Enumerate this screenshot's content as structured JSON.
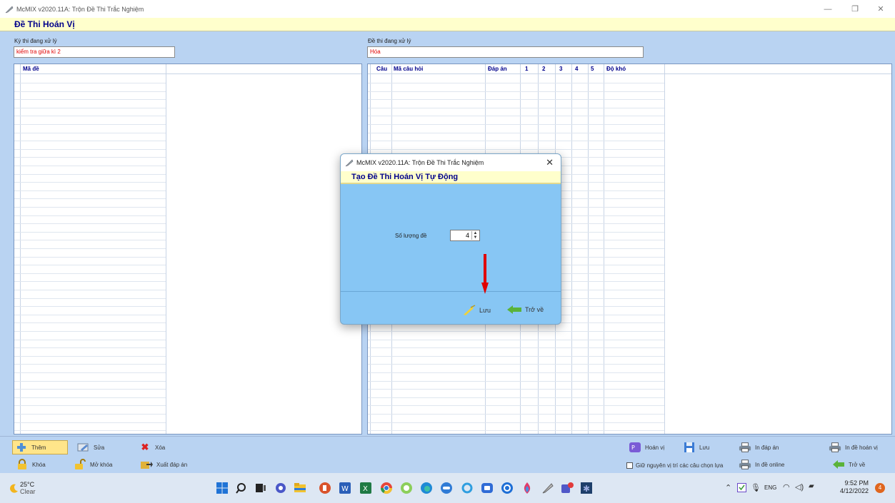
{
  "window": {
    "title": "McMIX v2020.11A: Trộn Đề Thi Trắc Nghiệm",
    "icon": "app-feather-icon"
  },
  "header": {
    "title": "Đề Thi Hoán Vị"
  },
  "left_panel": {
    "label": "Kỳ thi đang xử lý",
    "value": "kiểm tra giữa kì 2",
    "grid_columns": [
      "Mã đề"
    ]
  },
  "right_panel": {
    "label": "Đề thi đang xử lý",
    "value": "Hóa",
    "grid_columns": [
      "Câu",
      "Mã câu hỏi",
      "Đáp án",
      "1",
      "2",
      "3",
      "4",
      "5",
      "Độ khó"
    ]
  },
  "toolbar": {
    "add": "Thêm",
    "edit": "Sửa",
    "delete": "Xóa",
    "lock": "Khóa",
    "unlock": "Mở khóa",
    "export_answers": "Xuất đáp án",
    "permute": "Hoán vị",
    "save": "Lưu",
    "print_answers": "In đáp án",
    "print_permuted": "In đề hoán vị",
    "keep_position": "Giữ nguyên vị trí các câu chọn lựa",
    "print_online": "In đề online",
    "back": "Trở về"
  },
  "dialog": {
    "title": "McMIX v2020.11A: Trộn Đề Thi Trắc Nghiệm",
    "header": "Tạo Đề Thi Hoán Vị Tự Động",
    "count_label": "Số lượng đề",
    "count_value": "4",
    "save_label": "Lưu",
    "back_label": "Trở về"
  },
  "taskbar": {
    "temperature": "25°C",
    "weather": "Clear",
    "language": "ENG",
    "time": "9:52 PM",
    "date": "4/12/2022",
    "notification_count": "4"
  },
  "colors": {
    "panel_bg": "#b9d3f2",
    "header_bg": "#ffffcc",
    "heading_text": "#00008b",
    "field_text": "#e00000",
    "dialog_bg": "#87c6f4",
    "annotation_arrow": "#e00000"
  }
}
